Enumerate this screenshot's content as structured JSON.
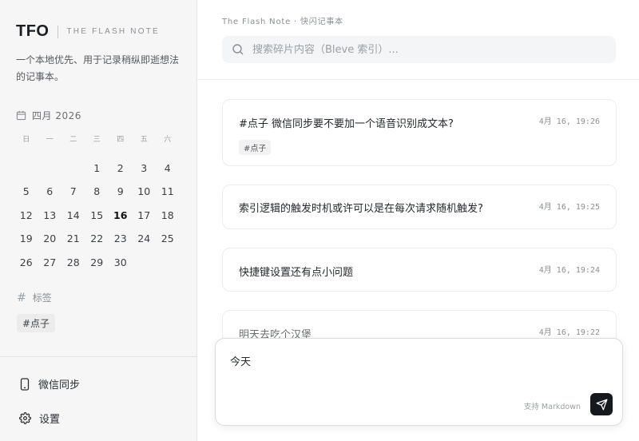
{
  "brand": {
    "logo": "TFO",
    "subtitle": "THE FLASH NOTE",
    "description": "一个本地优先、用于记录稍纵即逝想法的记事本。"
  },
  "calendar": {
    "title": "四月 2026",
    "weekdays": [
      "日",
      "一",
      "二",
      "三",
      "四",
      "五",
      "六"
    ],
    "leading_blanks": 3,
    "days": [
      "1",
      "2",
      "3",
      "4",
      "5",
      "6",
      "7",
      "8",
      "9",
      "10",
      "11",
      "12",
      "13",
      "14",
      "15",
      "16",
      "17",
      "18",
      "19",
      "20",
      "21",
      "22",
      "23",
      "24",
      "25",
      "26",
      "27",
      "28",
      "29",
      "30"
    ],
    "today": "16"
  },
  "tags": {
    "header": "标签",
    "items": [
      "#点子"
    ]
  },
  "nav": {
    "wechat_sync": "微信同步",
    "settings": "设置"
  },
  "header": {
    "breadcrumb": "The Flash Note · 快闪记事本",
    "search_placeholder": "搜索碎片内容（Bleve 索引）..."
  },
  "notes": [
    {
      "text": "#点子 微信同步要不要加一个语音识别成文本?",
      "time": "4月 16, 19:26",
      "tag": "#点子"
    },
    {
      "text": "索引逻辑的触发时机或许可以是在每次请求随机触发?",
      "time": "4月 16, 19:25"
    },
    {
      "text": "快捷键设置还有点小问题",
      "time": "4月 16, 19:24"
    },
    {
      "text": "明天去吃个汉堡",
      "time": "4月 16, 19:22"
    }
  ],
  "composer": {
    "value": "今天",
    "markdown_hint": "支持 Markdown"
  }
}
